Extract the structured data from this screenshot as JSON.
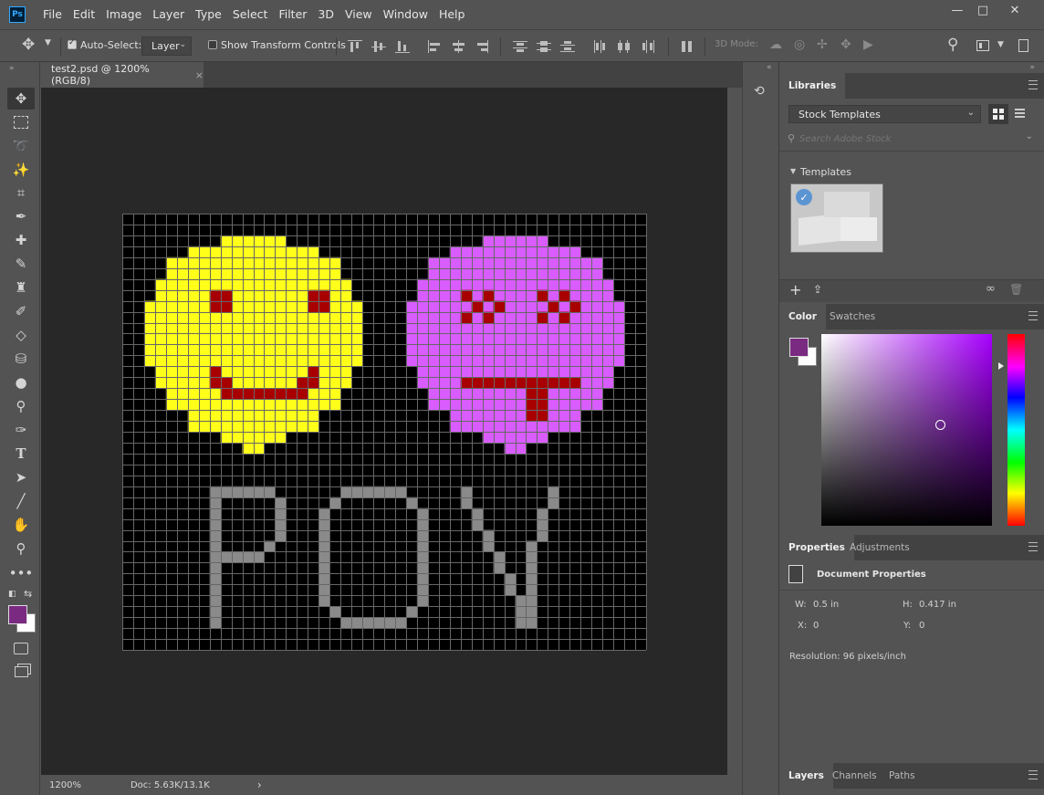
{
  "app": {
    "logo": "Ps",
    "menu": [
      "File",
      "Edit",
      "Image",
      "Layer",
      "Type",
      "Select",
      "Filter",
      "3D",
      "View",
      "Window",
      "Help"
    ],
    "window_controls": {
      "minimize": "—",
      "restore": "□",
      "close": "✕"
    }
  },
  "options_bar": {
    "auto_select_label": "Auto-Select:",
    "auto_select_checked": true,
    "target_value": "Layer",
    "show_transform_label": "Show Transform Controls",
    "show_transform_checked": false,
    "mode_3d_label": "3D Mode:"
  },
  "document": {
    "tab_title": "test2.psd @ 1200% (RGB/8)",
    "close_glyph": "×",
    "zoom": "1200%",
    "doc_info": "Doc: 5.63K/13.1K",
    "status_arrow": "›"
  },
  "artwork": {
    "grid_cols": 48,
    "grid_rows": 40,
    "smiley_color": "#ffff1a",
    "dead_face_color": "#d95cff",
    "feature_color": "#a80000",
    "text_color": "#8a8a8a"
  },
  "libraries": {
    "tab_label": "Libraries",
    "library_name": "Stock Templates",
    "search_placeholder": "Search Adobe Stock",
    "section_label": "Templates"
  },
  "color_panel": {
    "tabs": [
      "Color",
      "Swatches"
    ],
    "foreground": "#7b2a82",
    "background": "#ffffff"
  },
  "properties_panel": {
    "tabs": [
      "Properties",
      "Adjustments"
    ],
    "title": "Document Properties",
    "w_label": "W:",
    "w_value": "0.5 in",
    "h_label": "H:",
    "h_value": "0.417 in",
    "x_label": "X:",
    "x_value": "0",
    "y_label": "Y:",
    "y_value": "0",
    "resolution": "Resolution: 96 pixels/inch"
  },
  "layers_panel": {
    "tabs": [
      "Layers",
      "Channels",
      "Paths"
    ]
  }
}
